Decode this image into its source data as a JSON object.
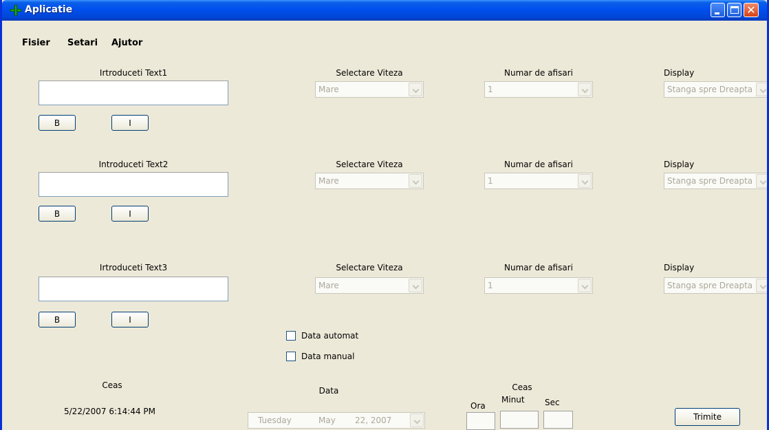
{
  "window": {
    "title": "Aplicatie"
  },
  "menu": {
    "items": [
      "Fisier",
      "Setari",
      "Ajutor"
    ]
  },
  "rows": [
    {
      "text_label": "Irtroduceti Text1",
      "text_value": "",
      "bold_label": "B",
      "italic_label": "I",
      "speed_label": "Selectare Viteza",
      "speed_value": "Mare",
      "count_label": "Numar de afisari",
      "count_value": "1",
      "display_label": "Display",
      "display_value": "Stanga spre Dreapta"
    },
    {
      "text_label": "Introduceti Text2",
      "text_value": "",
      "bold_label": "B",
      "italic_label": "I",
      "speed_label": "Selectare Viteza",
      "speed_value": "Mare",
      "count_label": "Numar de afisari",
      "count_value": "1",
      "display_label": "Display",
      "display_value": "Stanga spre Dreapta"
    },
    {
      "text_label": "Irtroduceti Text3",
      "text_value": "",
      "bold_label": "B",
      "italic_label": "I",
      "speed_label": "Selectare Viteza",
      "speed_value": "Mare",
      "count_label": "Numar de afisari",
      "count_value": "1",
      "display_label": "Display",
      "display_value": "Stanga spre Dreapta"
    }
  ],
  "checkboxes": {
    "auto_label": "Data automat",
    "manual_label": "Data manual"
  },
  "clock": {
    "label": "Ceas",
    "value": "5/22/2007 6:14:44 PM"
  },
  "date": {
    "label": "Data",
    "weekday": "Tuesday",
    "month": "May",
    "day_year": "22, 2007"
  },
  "manual_clock": {
    "label": "Ceas",
    "hour_label": "Ora",
    "minute_label": "Minut",
    "second_label": "Sec"
  },
  "send_button": "Trimite",
  "colors": {
    "titlebar": "#0050ee",
    "window_bg": "#ece9d8",
    "disabled_text": "#aca899"
  }
}
